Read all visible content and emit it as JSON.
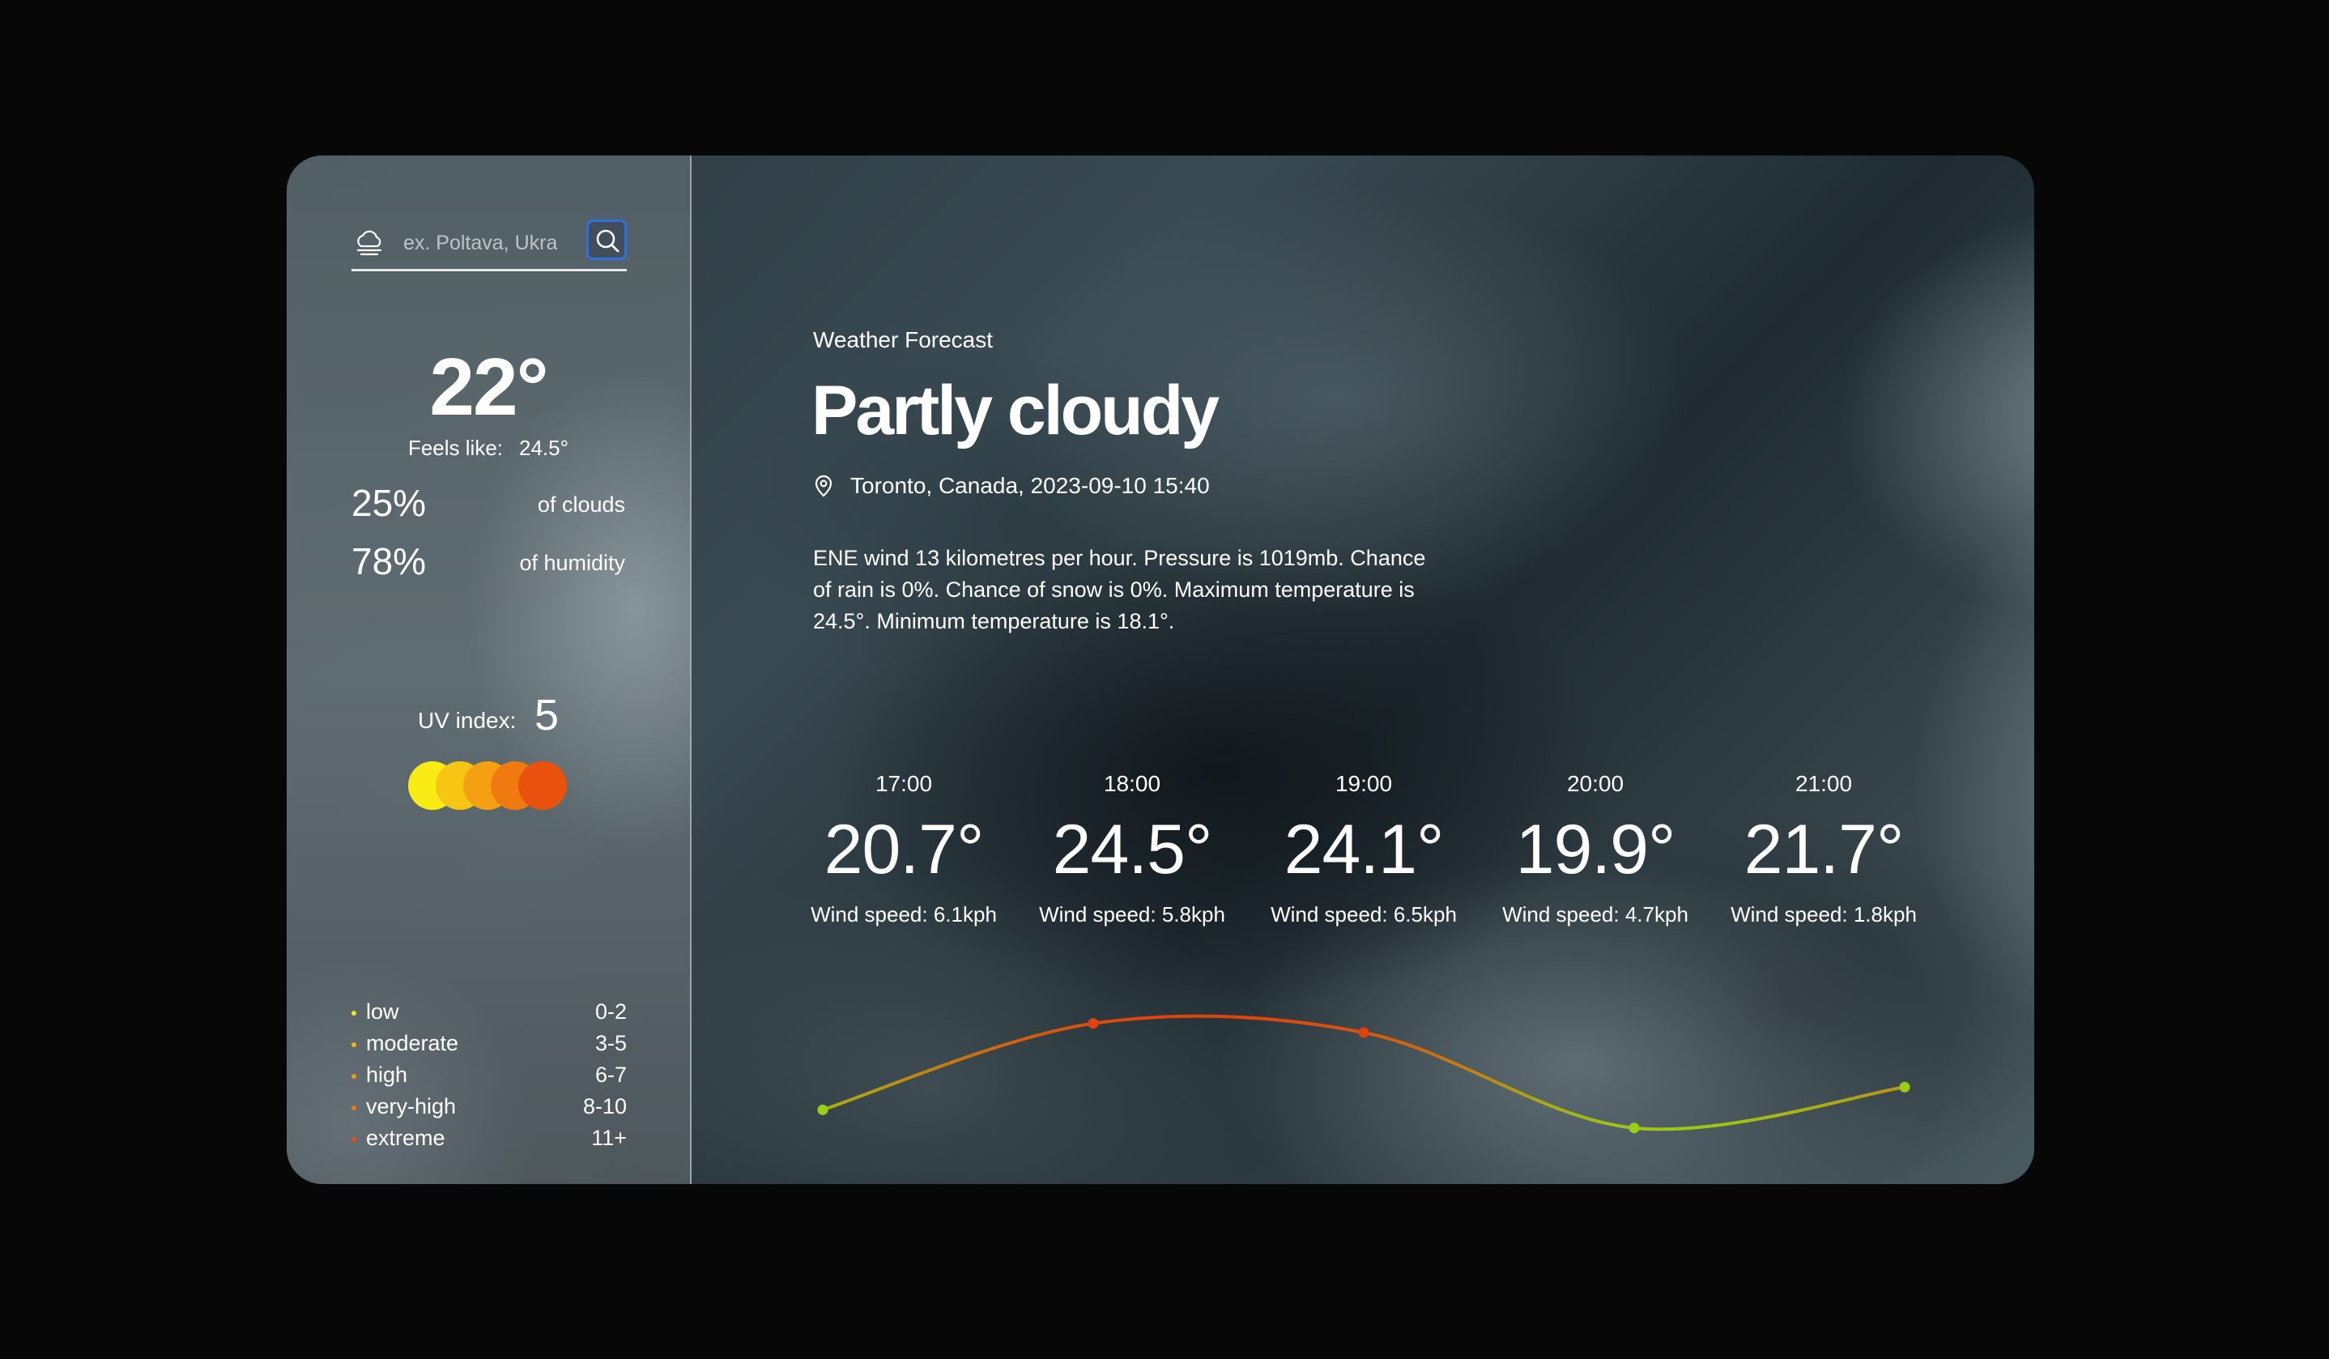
{
  "search": {
    "placeholder": "ex. Poltava, Ukra"
  },
  "current": {
    "temperature": "22°",
    "feels_like_label": "Feels like:",
    "feels_like_value": "24.5°",
    "clouds_value": "25%",
    "clouds_label": "of clouds",
    "humidity_value": "78%",
    "humidity_label": "of humidity"
  },
  "uv": {
    "label": "UV index:",
    "value": "5",
    "scale_colors": [
      "#f8ec14",
      "#f7c514",
      "#f4a012",
      "#f07a10",
      "#e8520c"
    ],
    "levels": [
      {
        "name": "low",
        "range": "0-2",
        "color": "#f8e41a"
      },
      {
        "name": "moderate",
        "range": "3-5",
        "color": "#f6b21a"
      },
      {
        "name": "high",
        "range": "6-7",
        "color": "#f39a16"
      },
      {
        "name": "very-high",
        "range": "8-10",
        "color": "#f07a12"
      },
      {
        "name": "extreme",
        "range": "11+",
        "color": "#e8520c"
      }
    ]
  },
  "main": {
    "subtitle": "Weather Forecast",
    "condition": "Partly cloudy",
    "location": "Toronto, Canada, 2023-09-10 15:40",
    "description": "ENE wind 13 kilometres per hour. Pressure is 1019mb. Chance of rain is 0%. Chance of snow is 0%. Maximum temperature is 24.5°. Minimum temperature is 18.1°."
  },
  "hourly": [
    {
      "time": "17:00",
      "temp": "20.7°",
      "wind": "Wind speed: 6.1kph"
    },
    {
      "time": "18:00",
      "temp": "24.5°",
      "wind": "Wind speed: 5.8kph"
    },
    {
      "time": "19:00",
      "temp": "24.1°",
      "wind": "Wind speed: 6.5kph"
    },
    {
      "time": "20:00",
      "temp": "19.9°",
      "wind": "Wind speed: 4.7kph"
    },
    {
      "time": "21:00",
      "temp": "21.7°",
      "wind": "Wind speed: 1.8kph"
    }
  ],
  "chart_data": {
    "type": "line",
    "categories": [
      "17:00",
      "18:00",
      "19:00",
      "20:00",
      "21:00"
    ],
    "values": [
      20.7,
      24.5,
      24.1,
      19.9,
      21.7
    ],
    "colors": {
      "low": "#9acd16",
      "high": "#e0420e"
    }
  }
}
